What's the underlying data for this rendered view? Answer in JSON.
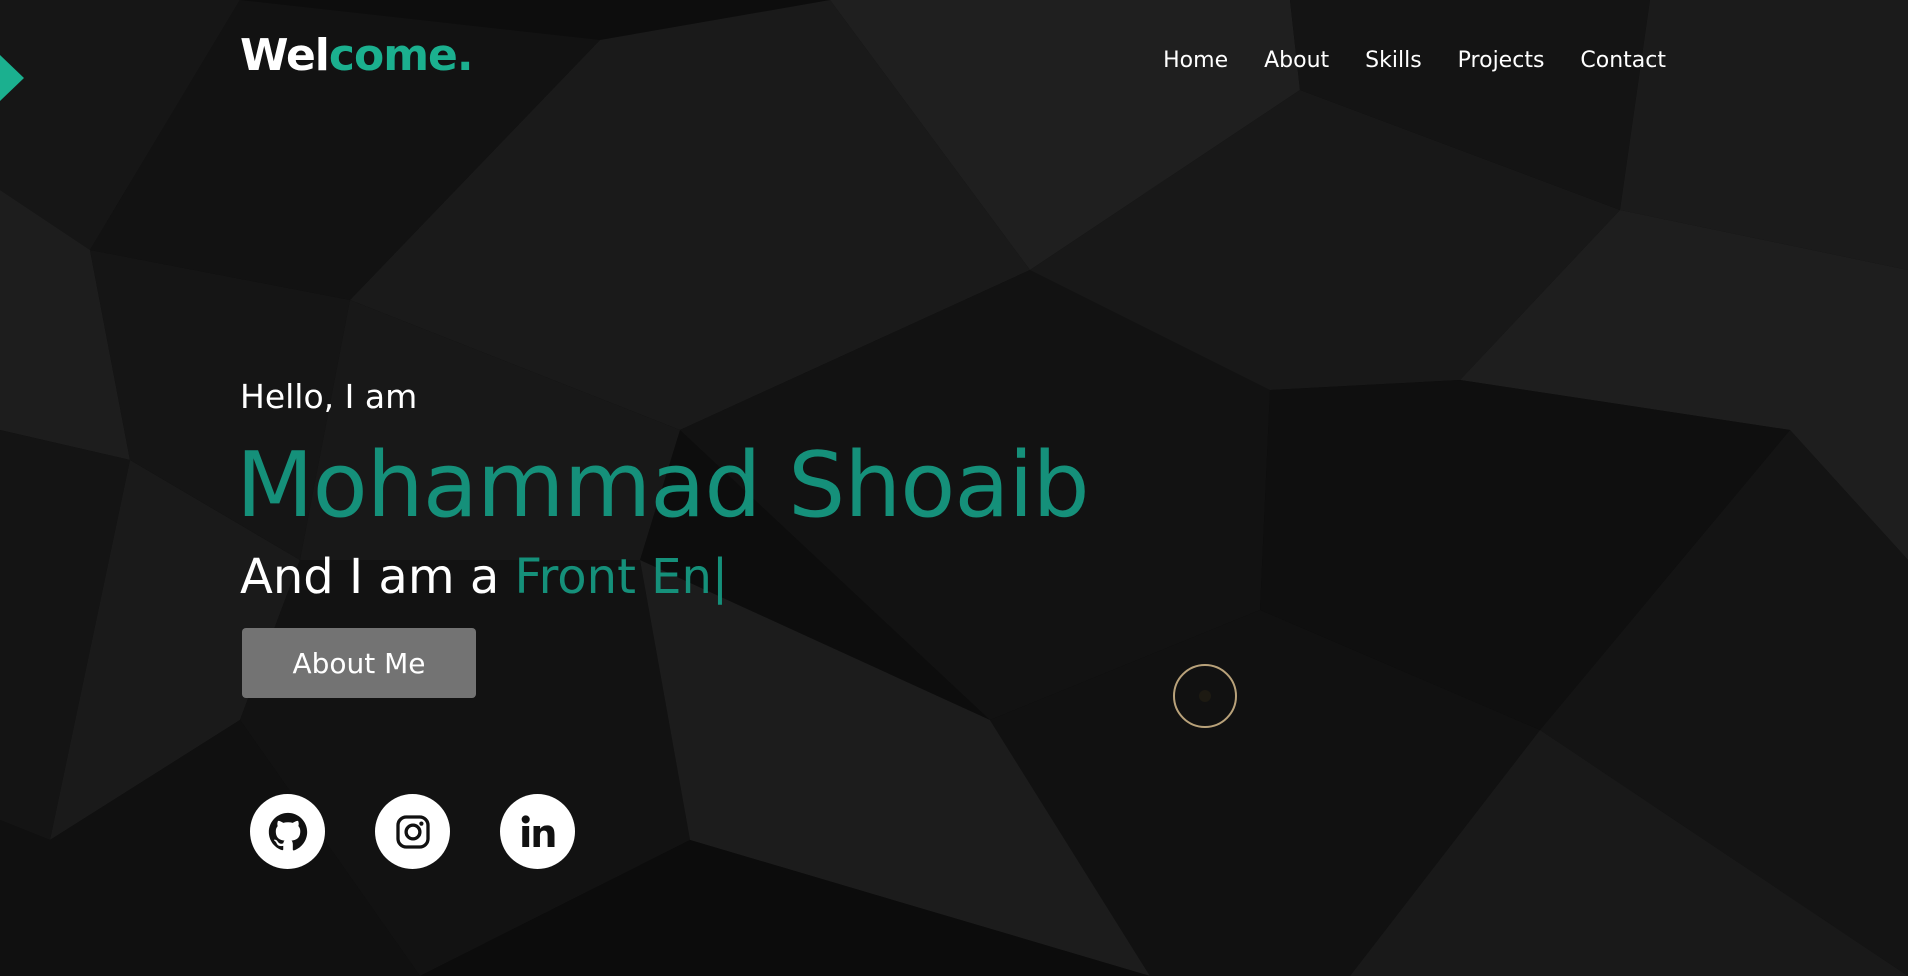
{
  "header": {
    "logo_main": "Wel",
    "logo_accent": "come.",
    "nav": [
      "Home",
      "About",
      "Skills",
      "Projects",
      "Contact"
    ]
  },
  "hero": {
    "greeting": "Hello, I am",
    "name": "Mohammad Shoaib",
    "role_prefix": "And I am a ",
    "role_typed": "Front En",
    "cursor": "|",
    "button_label": "About Me"
  },
  "socials": [
    {
      "icon": "github-icon"
    },
    {
      "icon": "instagram-icon"
    },
    {
      "icon": "linkedin-icon"
    }
  ],
  "colors": {
    "accent": "#1bb08f",
    "accent_text": "#15907a",
    "button": "#737373",
    "background": "#0b0b0b"
  }
}
